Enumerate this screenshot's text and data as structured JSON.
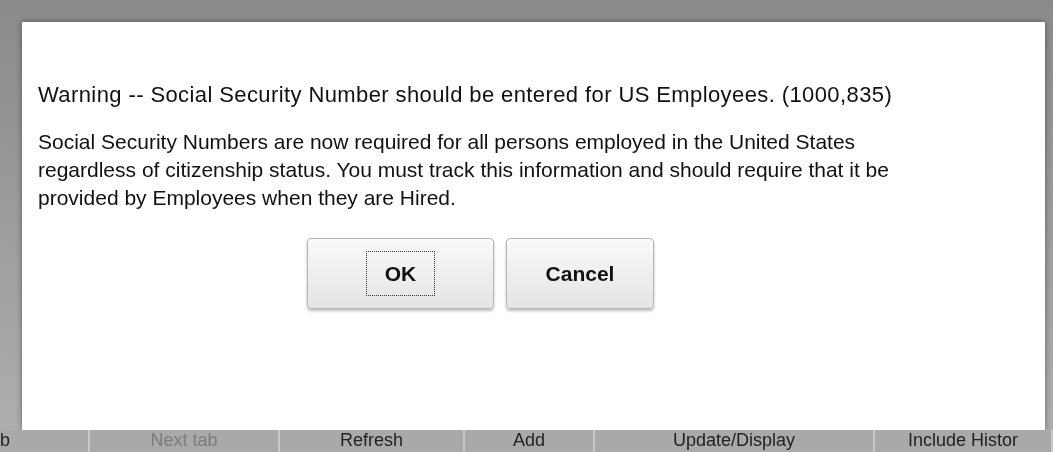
{
  "dialog": {
    "warning": "Warning -- Social Security Number should be entered for US Employees. (1000,835)",
    "message": "Social Security Numbers are now required for all persons employed in the United States regardless of citizenship status. You must track this information and should require that it be provided by Employees when they are Hired.",
    "buttons": [
      {
        "label": "OK",
        "focused": true
      },
      {
        "label": "Cancel",
        "focused": false
      }
    ]
  },
  "toolbar": [
    {
      "label": "b",
      "disabled": false
    },
    {
      "label": "Next tab",
      "disabled": true
    },
    {
      "label": "Refresh",
      "disabled": false
    },
    {
      "label": "Add",
      "disabled": false
    },
    {
      "label": "Update/Display",
      "disabled": false
    },
    {
      "label": "Include Histor",
      "disabled": false
    }
  ]
}
